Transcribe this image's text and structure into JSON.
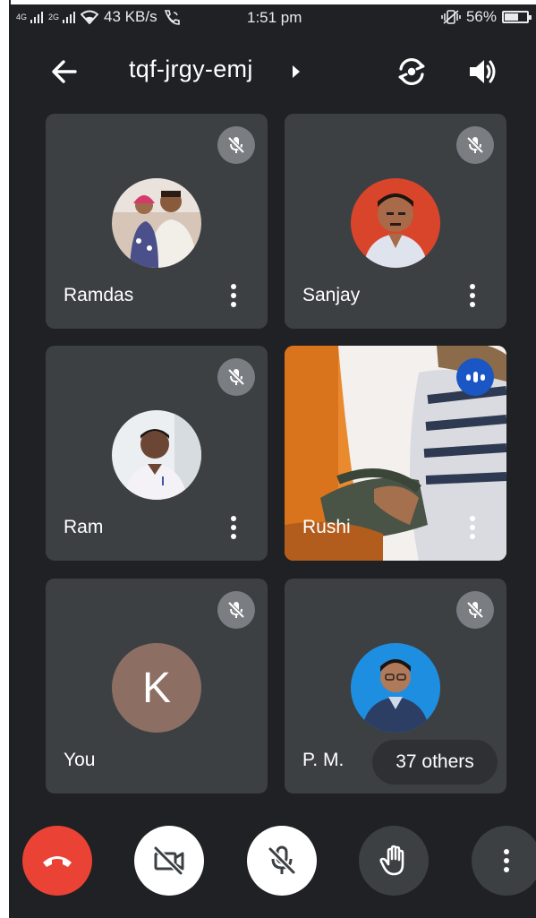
{
  "status_bar": {
    "network_left": "4G",
    "network_right": "2G",
    "speed": "43 KB/s",
    "time": "1:51 pm",
    "battery": "56%",
    "battery_level": 0.56
  },
  "header": {
    "meeting_code": "tqf-jrgy-emj"
  },
  "participants": [
    {
      "name": "Ramdas",
      "muted": true
    },
    {
      "name": "Sanjay",
      "muted": true
    },
    {
      "name": "Ram",
      "muted": true
    },
    {
      "name": "Rushi",
      "muted": false,
      "speaking": true,
      "video_on": true
    },
    {
      "name": "You",
      "muted": true,
      "avatar_letter": "K"
    },
    {
      "name": "P. M.",
      "muted": true
    }
  ],
  "others_chip": {
    "label": "37 others"
  },
  "colors": {
    "background": "#202124",
    "tile": "#3c4043",
    "end_call": "#ea4335",
    "speaking": "#1a56c4",
    "letter_avatar": "#8d6e63"
  },
  "icons": [
    "back-arrow-icon",
    "caret-right-icon",
    "camera-switch-icon",
    "speaker-icon",
    "mic-off-icon",
    "more-vert-icon",
    "end-call-icon",
    "camera-off-icon",
    "hand-raise-icon"
  ]
}
